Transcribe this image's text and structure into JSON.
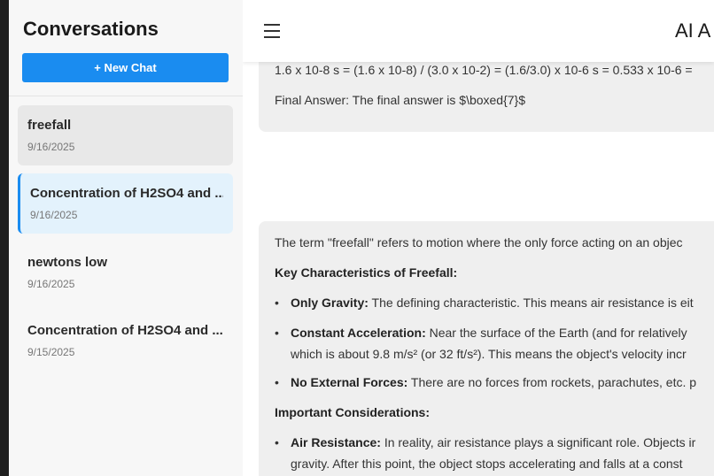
{
  "sidebar": {
    "title": "Conversations",
    "new_chat_label": "+ New Chat",
    "conversations": [
      {
        "title": "freefall",
        "date": "9/16/2025"
      },
      {
        "title": "Concentration of H2SO4 and ...",
        "date": "9/16/2025"
      },
      {
        "title": "newtons low",
        "date": "9/16/2025"
      },
      {
        "title": "Concentration of H2SO4 and ...",
        "date": "9/15/2025"
      }
    ]
  },
  "header": {
    "title": "AI A"
  },
  "messages": {
    "first": {
      "line1": "1.6 x 10-8 s = (1.6 x 10-8) / (3.0 x 10-2) = (1.6/3.0) x 10-6 s = 0.533 x 10-6 =",
      "line2": "Final Answer: The final answer is $\\boxed{7}$"
    },
    "second": {
      "intro": "The term \"freefall\" refers to motion where the only force acting on an objec",
      "heading1": "Key Characteristics of Freefall:",
      "bullets1": [
        {
          "bold": "Only Gravity:",
          "text": " The defining characteristic. This means air resistance is eit"
        },
        {
          "bold": "Constant Acceleration:",
          "text": " Near the surface of the Earth (and for relatively",
          "line2": "which is about 9.8 m/s² (or 32 ft/s²). This means the object's velocity incr"
        },
        {
          "bold": "No External Forces:",
          "text": " There are no forces from rockets, parachutes, etc. p"
        }
      ],
      "heading2": "Important Considerations:",
      "bullets2": [
        {
          "bold": "Air Resistance:",
          "text": " In reality, air resistance plays a significant role. Objects ir",
          "line2": "gravity. After this point, the object stops accelerating and falls at a const"
        }
      ]
    }
  },
  "colors": {
    "accent": "#1a8cf0",
    "active_item_bg": "#e3f2fc",
    "card_bg": "#efefef",
    "sidebar_bg": "#f7f7f7"
  },
  "icons": {
    "menu": "hamburger-menu-icon"
  }
}
